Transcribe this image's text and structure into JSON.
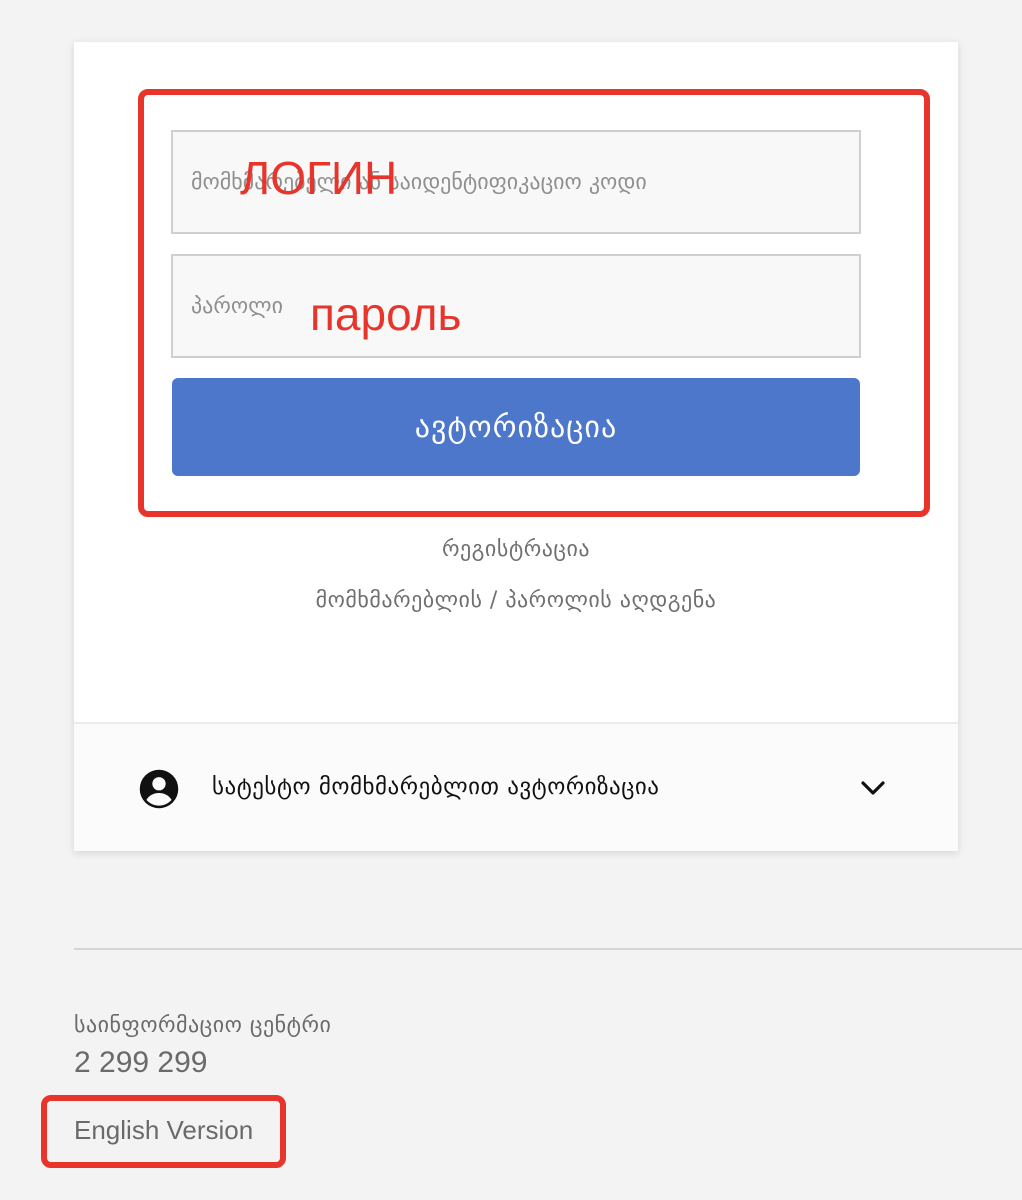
{
  "login": {
    "username_placeholder": "მომხმარებელი ან საიდენტიფიკაციო კოდი",
    "password_placeholder": "პაროლი",
    "submit_label": "ავტორიზაცია",
    "register_label": "რეგისტრაცია",
    "recover_label": "მომხმარებლის / პაროლის აღდგენა"
  },
  "annotations": {
    "login_label": "ЛОГИН",
    "password_label": "пароль",
    "color": "#e8352b"
  },
  "test_user": {
    "label": "სატესტო მომხმარებლით ავტორიზაცია",
    "icon": "account-circle-icon",
    "toggle_icon": "chevron-down-icon"
  },
  "footer": {
    "info_title": "საინფორმაციო ცენტრი",
    "phone": "2 299 299",
    "language_link": "English Version"
  },
  "colors": {
    "primary_button": "#4c77cb",
    "background": "#f3f3f3"
  }
}
